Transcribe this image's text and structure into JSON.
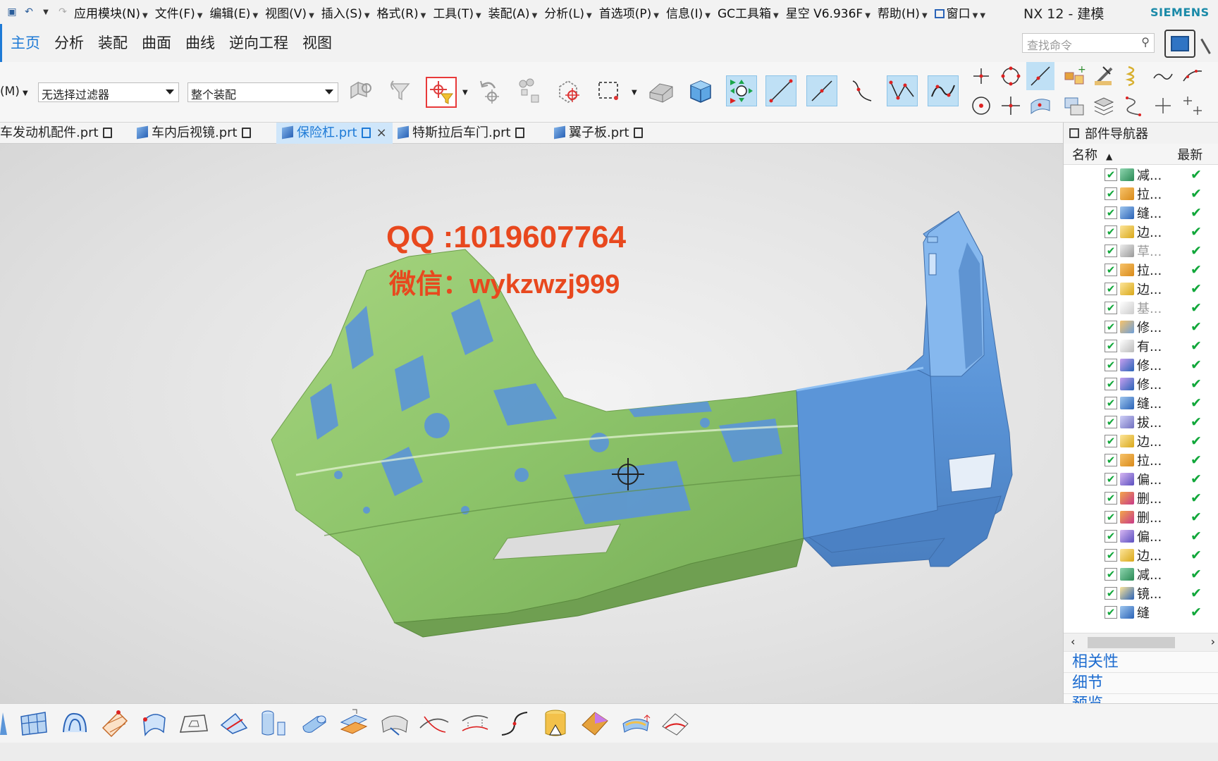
{
  "menubar": {
    "items": [
      {
        "label": "应用模块(N)"
      },
      {
        "label": "文件(F)"
      },
      {
        "label": "编辑(E)"
      },
      {
        "label": "视图(V)"
      },
      {
        "label": "插入(S)"
      },
      {
        "label": "格式(R)"
      },
      {
        "label": "工具(T)"
      },
      {
        "label": "装配(A)"
      },
      {
        "label": "分析(L)"
      },
      {
        "label": "首选项(P)"
      },
      {
        "label": "信息(I)"
      },
      {
        "label": "GC工具箱"
      },
      {
        "label": "星空 V6.936F"
      },
      {
        "label": "帮助(H)"
      },
      {
        "label": "窗口"
      }
    ],
    "window_title": "NX 12 - 建模",
    "brand": "SIEMENS"
  },
  "ribbon": {
    "tabs": [
      {
        "label": "主页",
        "active": true
      },
      {
        "label": "分析",
        "active": false
      },
      {
        "label": "装配",
        "active": false
      },
      {
        "label": "曲面",
        "active": false
      },
      {
        "label": "曲线",
        "active": false
      },
      {
        "label": "逆向工程",
        "active": false
      },
      {
        "label": "视图",
        "active": false
      }
    ],
    "search_placeholder": "查找命令"
  },
  "toolbar": {
    "selection_mode": "(M)",
    "filter_value": "无选择过滤器",
    "scope_value": "整个装配"
  },
  "doc_tabs": [
    {
      "label": "车发动机配件.prt",
      "active": false
    },
    {
      "label": "车内后视镜.prt",
      "active": false
    },
    {
      "label": "保险杠.prt",
      "active": true
    },
    {
      "label": "特斯拉后车门.prt",
      "active": false
    },
    {
      "label": "翼子板.prt",
      "active": false
    }
  ],
  "viewport": {
    "watermark_qq": "QQ :1019607764",
    "watermark_wechat": "微信：wykzwzj999",
    "colors": {
      "green": "#8dc46a",
      "blue": "#5b95d8"
    }
  },
  "navigator": {
    "title": "部件导航器",
    "col_name": "名称",
    "col_latest": "最新",
    "rows": [
      {
        "label": "减...",
        "icon": "subtract-icon",
        "dim": false
      },
      {
        "label": "拉...",
        "icon": "extrude-icon",
        "dim": false
      },
      {
        "label": "缝...",
        "icon": "sew-icon",
        "dim": false
      },
      {
        "label": "边...",
        "icon": "edge-blend-icon",
        "dim": false
      },
      {
        "label": "草...",
        "icon": "sketch-icon",
        "dim": true
      },
      {
        "label": "拉...",
        "icon": "extrude-icon",
        "dim": false
      },
      {
        "label": "边...",
        "icon": "edge-blend-icon",
        "dim": false
      },
      {
        "label": "基...",
        "icon": "datum-plane-icon",
        "dim": true
      },
      {
        "label": "修...",
        "icon": "trim-icon",
        "dim": false
      },
      {
        "label": "有...",
        "icon": "bounded-plane-icon",
        "dim": false
      },
      {
        "label": "修...",
        "icon": "trim-sheet-icon",
        "dim": false
      },
      {
        "label": "修...",
        "icon": "trim-sheet-icon",
        "dim": false
      },
      {
        "label": "缝...",
        "icon": "sew-icon",
        "dim": false
      },
      {
        "label": "拔...",
        "icon": "draft-icon",
        "dim": false
      },
      {
        "label": "边...",
        "icon": "edge-blend-icon",
        "dim": false
      },
      {
        "label": "拉...",
        "icon": "extrude-icon",
        "dim": false
      },
      {
        "label": "偏...",
        "icon": "offset-icon",
        "dim": false
      },
      {
        "label": "删...",
        "icon": "delete-face-icon",
        "dim": false
      },
      {
        "label": "删...",
        "icon": "delete-face-icon",
        "dim": false
      },
      {
        "label": "偏...",
        "icon": "offset-icon",
        "dim": false
      },
      {
        "label": "边...",
        "icon": "edge-blend-icon",
        "dim": false
      },
      {
        "label": "减...",
        "icon": "subtract-icon",
        "dim": false
      },
      {
        "label": "镜...",
        "icon": "mirror-icon",
        "dim": false
      },
      {
        "label": "缝",
        "icon": "sew-icon",
        "dim": false
      }
    ],
    "sections": [
      {
        "label": "相关性"
      },
      {
        "label": "细节"
      },
      {
        "label": "预览"
      }
    ]
  }
}
